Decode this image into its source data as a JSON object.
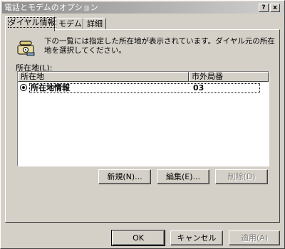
{
  "window": {
    "title": "電話とモデムのオプション",
    "help_button": "?",
    "close_button": "x"
  },
  "tabs": [
    {
      "label": "ダイヤル情報",
      "active": true
    },
    {
      "label": "モデム",
      "active": false
    },
    {
      "label": "詳細",
      "active": false
    }
  ],
  "dialing_tab": {
    "description": "下の一覧には指定した所在地が表示されています。ダイヤル元の所在地を選択してください。",
    "locations_label": "所在地(L):",
    "columns": [
      "所在地",
      "市外局番"
    ],
    "rows": [
      {
        "location": "所在地情報",
        "area_code": "03",
        "selected": true
      }
    ],
    "buttons": {
      "new": "新規(N)...",
      "edit": "編集(E)...",
      "delete": "削除(D)"
    }
  },
  "footer": {
    "ok": "OK",
    "cancel": "キャンセル",
    "apply": "適用(A)"
  },
  "colors": {
    "face": "#d4d0c8",
    "titlebar_start": "#8e8e8e",
    "titlebar_end": "#cfcfcf"
  }
}
